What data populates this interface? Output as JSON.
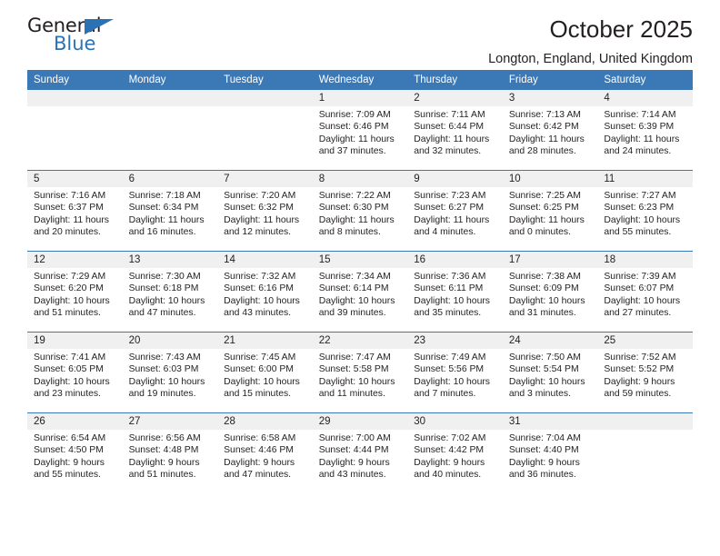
{
  "brand": {
    "name_top": "General",
    "name_bottom": "Blue",
    "triangle_color": "#2b72b5"
  },
  "header": {
    "title": "October 2025",
    "subtitle": "Longton, England, United Kingdom",
    "accent_color": "#3b78b6"
  },
  "calendar": {
    "weekday_headers": [
      "Sunday",
      "Monday",
      "Tuesday",
      "Wednesday",
      "Thursday",
      "Friday",
      "Saturday"
    ],
    "labels": {
      "sunrise": "Sunrise:",
      "sunset": "Sunset:",
      "daylight": "Daylight:"
    },
    "weeks": [
      [
        {
          "day": "",
          "empty": true
        },
        {
          "day": "",
          "empty": true
        },
        {
          "day": "",
          "empty": true
        },
        {
          "day": "1",
          "sunrise": "Sunrise: 7:09 AM",
          "sunset": "Sunset: 6:46 PM",
          "daylight": "Daylight: 11 hours and 37 minutes."
        },
        {
          "day": "2",
          "sunrise": "Sunrise: 7:11 AM",
          "sunset": "Sunset: 6:44 PM",
          "daylight": "Daylight: 11 hours and 32 minutes."
        },
        {
          "day": "3",
          "sunrise": "Sunrise: 7:13 AM",
          "sunset": "Sunset: 6:42 PM",
          "daylight": "Daylight: 11 hours and 28 minutes."
        },
        {
          "day": "4",
          "sunrise": "Sunrise: 7:14 AM",
          "sunset": "Sunset: 6:39 PM",
          "daylight": "Daylight: 11 hours and 24 minutes."
        }
      ],
      [
        {
          "day": "5",
          "sunrise": "Sunrise: 7:16 AM",
          "sunset": "Sunset: 6:37 PM",
          "daylight": "Daylight: 11 hours and 20 minutes."
        },
        {
          "day": "6",
          "sunrise": "Sunrise: 7:18 AM",
          "sunset": "Sunset: 6:34 PM",
          "daylight": "Daylight: 11 hours and 16 minutes."
        },
        {
          "day": "7",
          "sunrise": "Sunrise: 7:20 AM",
          "sunset": "Sunset: 6:32 PM",
          "daylight": "Daylight: 11 hours and 12 minutes."
        },
        {
          "day": "8",
          "sunrise": "Sunrise: 7:22 AM",
          "sunset": "Sunset: 6:30 PM",
          "daylight": "Daylight: 11 hours and 8 minutes."
        },
        {
          "day": "9",
          "sunrise": "Sunrise: 7:23 AM",
          "sunset": "Sunset: 6:27 PM",
          "daylight": "Daylight: 11 hours and 4 minutes."
        },
        {
          "day": "10",
          "sunrise": "Sunrise: 7:25 AM",
          "sunset": "Sunset: 6:25 PM",
          "daylight": "Daylight: 11 hours and 0 minutes."
        },
        {
          "day": "11",
          "sunrise": "Sunrise: 7:27 AM",
          "sunset": "Sunset: 6:23 PM",
          "daylight": "Daylight: 10 hours and 55 minutes."
        }
      ],
      [
        {
          "day": "12",
          "sunrise": "Sunrise: 7:29 AM",
          "sunset": "Sunset: 6:20 PM",
          "daylight": "Daylight: 10 hours and 51 minutes."
        },
        {
          "day": "13",
          "sunrise": "Sunrise: 7:30 AM",
          "sunset": "Sunset: 6:18 PM",
          "daylight": "Daylight: 10 hours and 47 minutes."
        },
        {
          "day": "14",
          "sunrise": "Sunrise: 7:32 AM",
          "sunset": "Sunset: 6:16 PM",
          "daylight": "Daylight: 10 hours and 43 minutes."
        },
        {
          "day": "15",
          "sunrise": "Sunrise: 7:34 AM",
          "sunset": "Sunset: 6:14 PM",
          "daylight": "Daylight: 10 hours and 39 minutes."
        },
        {
          "day": "16",
          "sunrise": "Sunrise: 7:36 AM",
          "sunset": "Sunset: 6:11 PM",
          "daylight": "Daylight: 10 hours and 35 minutes."
        },
        {
          "day": "17",
          "sunrise": "Sunrise: 7:38 AM",
          "sunset": "Sunset: 6:09 PM",
          "daylight": "Daylight: 10 hours and 31 minutes."
        },
        {
          "day": "18",
          "sunrise": "Sunrise: 7:39 AM",
          "sunset": "Sunset: 6:07 PM",
          "daylight": "Daylight: 10 hours and 27 minutes."
        }
      ],
      [
        {
          "day": "19",
          "sunrise": "Sunrise: 7:41 AM",
          "sunset": "Sunset: 6:05 PM",
          "daylight": "Daylight: 10 hours and 23 minutes."
        },
        {
          "day": "20",
          "sunrise": "Sunrise: 7:43 AM",
          "sunset": "Sunset: 6:03 PM",
          "daylight": "Daylight: 10 hours and 19 minutes."
        },
        {
          "day": "21",
          "sunrise": "Sunrise: 7:45 AM",
          "sunset": "Sunset: 6:00 PM",
          "daylight": "Daylight: 10 hours and 15 minutes."
        },
        {
          "day": "22",
          "sunrise": "Sunrise: 7:47 AM",
          "sunset": "Sunset: 5:58 PM",
          "daylight": "Daylight: 10 hours and 11 minutes."
        },
        {
          "day": "23",
          "sunrise": "Sunrise: 7:49 AM",
          "sunset": "Sunset: 5:56 PM",
          "daylight": "Daylight: 10 hours and 7 minutes."
        },
        {
          "day": "24",
          "sunrise": "Sunrise: 7:50 AM",
          "sunset": "Sunset: 5:54 PM",
          "daylight": "Daylight: 10 hours and 3 minutes."
        },
        {
          "day": "25",
          "sunrise": "Sunrise: 7:52 AM",
          "sunset": "Sunset: 5:52 PM",
          "daylight": "Daylight: 9 hours and 59 minutes."
        }
      ],
      [
        {
          "day": "26",
          "sunrise": "Sunrise: 6:54 AM",
          "sunset": "Sunset: 4:50 PM",
          "daylight": "Daylight: 9 hours and 55 minutes."
        },
        {
          "day": "27",
          "sunrise": "Sunrise: 6:56 AM",
          "sunset": "Sunset: 4:48 PM",
          "daylight": "Daylight: 9 hours and 51 minutes."
        },
        {
          "day": "28",
          "sunrise": "Sunrise: 6:58 AM",
          "sunset": "Sunset: 4:46 PM",
          "daylight": "Daylight: 9 hours and 47 minutes."
        },
        {
          "day": "29",
          "sunrise": "Sunrise: 7:00 AM",
          "sunset": "Sunset: 4:44 PM",
          "daylight": "Daylight: 9 hours and 43 minutes."
        },
        {
          "day": "30",
          "sunrise": "Sunrise: 7:02 AM",
          "sunset": "Sunset: 4:42 PM",
          "daylight": "Daylight: 9 hours and 40 minutes."
        },
        {
          "day": "31",
          "sunrise": "Sunrise: 7:04 AM",
          "sunset": "Sunset: 4:40 PM",
          "daylight": "Daylight: 9 hours and 36 minutes."
        },
        {
          "day": "",
          "empty": true
        }
      ]
    ]
  }
}
